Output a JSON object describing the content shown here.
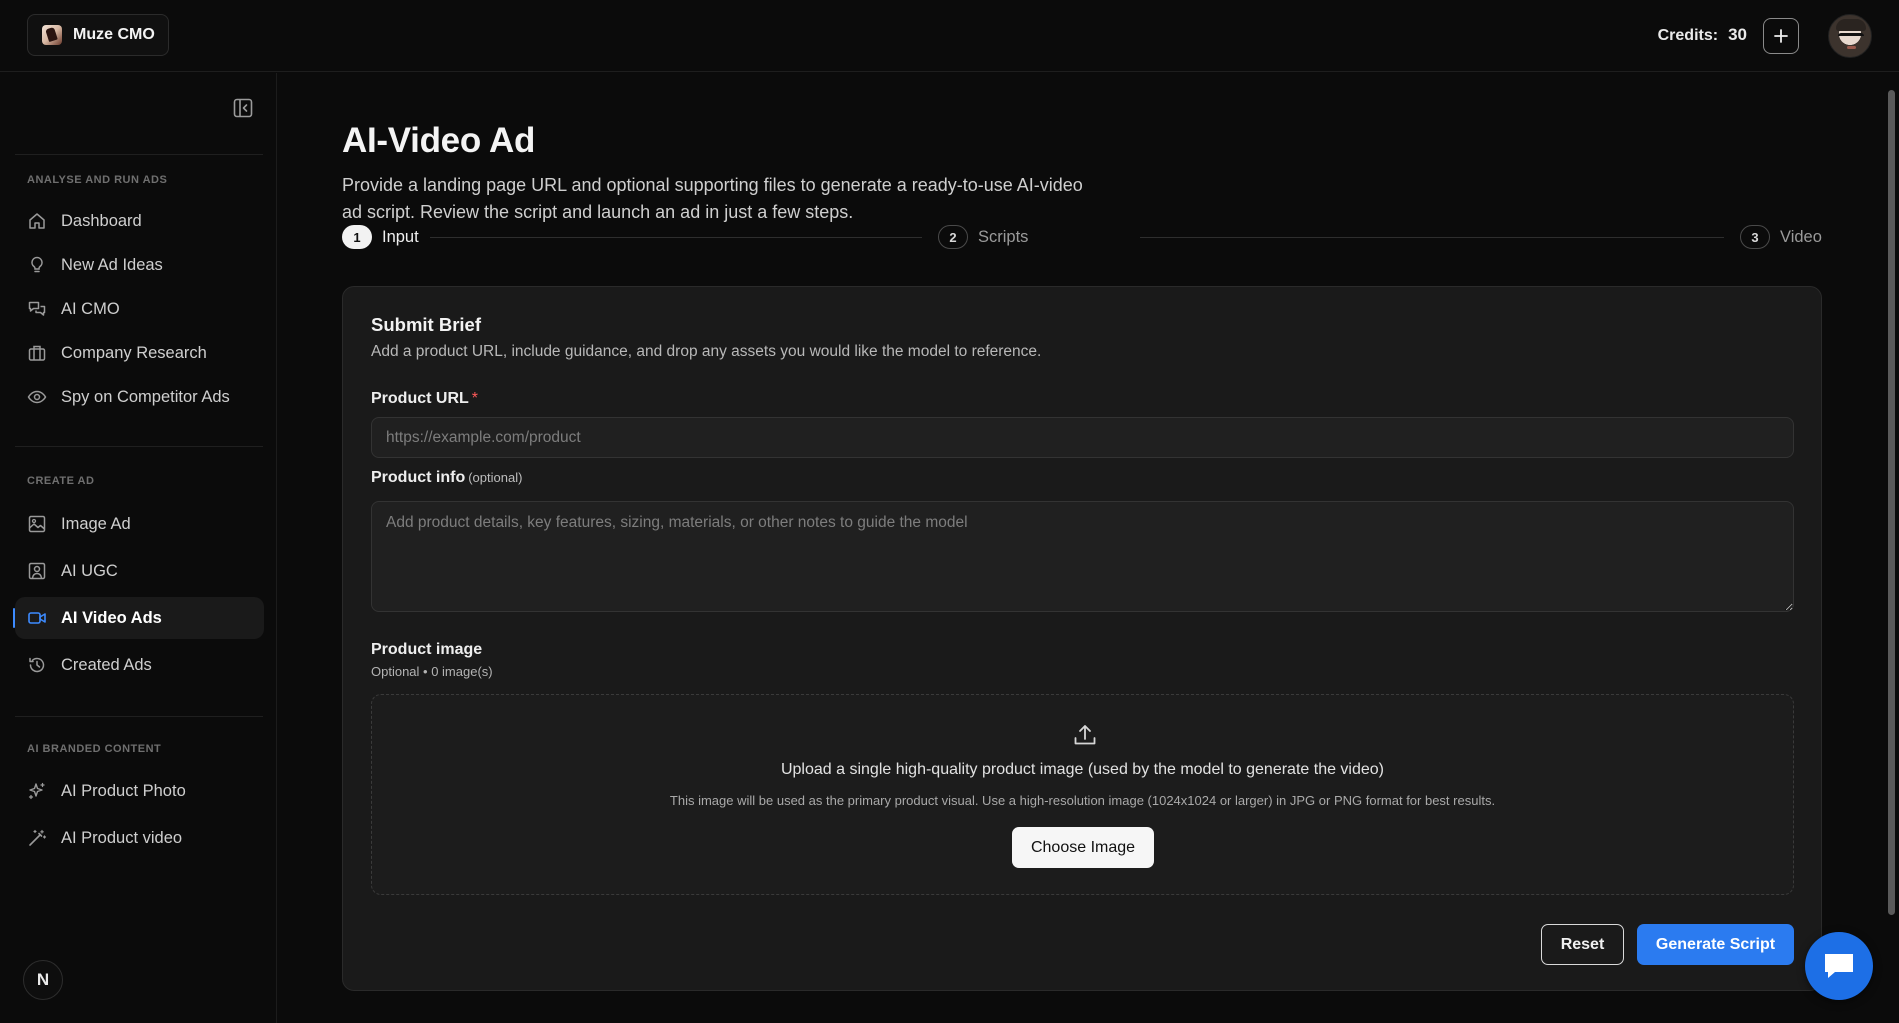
{
  "brand": {
    "name": "Muze CMO"
  },
  "header": {
    "credits_label": "Credits:",
    "credits_value": "30"
  },
  "sidebar": {
    "sections": [
      {
        "title": "ANALYSE AND RUN ADS"
      },
      {
        "title": "CREATE AD"
      },
      {
        "title": "AI BRANDED CONTENT"
      }
    ],
    "items": [
      {
        "label": "Dashboard",
        "icon": "home-icon"
      },
      {
        "label": "New Ad Ideas",
        "icon": "lightbulb-icon"
      },
      {
        "label": "AI CMO",
        "icon": "chat-bubbles-icon"
      },
      {
        "label": "Company Research",
        "icon": "briefcase-icon"
      },
      {
        "label": "Spy on Competitor Ads",
        "icon": "eye-icon"
      },
      {
        "label": "Image Ad",
        "icon": "image-icon"
      },
      {
        "label": "AI UGC",
        "icon": "user-square-icon"
      },
      {
        "label": "AI Video Ads",
        "icon": "video-camera-icon",
        "active": true
      },
      {
        "label": "Created Ads",
        "icon": "history-icon"
      },
      {
        "label": "AI Product Photo",
        "icon": "sparkles-icon"
      },
      {
        "label": "AI Product video",
        "icon": "magic-wand-icon"
      }
    ],
    "footer_badge": "N"
  },
  "main": {
    "title": "AI-Video Ad",
    "description": "Provide a landing page URL and optional supporting files to generate a ready-to-use AI-video ad script. Review the script and launch an ad in just a few steps.",
    "steps": [
      {
        "number": "1",
        "label": "Input",
        "active": true
      },
      {
        "number": "2",
        "label": "Scripts",
        "active": false
      },
      {
        "number": "3",
        "label": "Video",
        "active": false
      }
    ],
    "card": {
      "title": "Submit Brief",
      "subtitle": "Add a product URL, include guidance, and drop any assets you would like the model to reference.",
      "product_url": {
        "label": "Product URL",
        "required_mark": "*",
        "placeholder": "https://example.com/product",
        "value": ""
      },
      "product_info": {
        "label": "Product info",
        "optional_tag": "(optional)",
        "placeholder": "Add product details, key features, sizing, materials, or other notes to guide the model",
        "value": ""
      },
      "product_image": {
        "label": "Product image",
        "note": "Optional • 0 image(s)",
        "upload_title": "Upload a single high-quality product image (used by the model to generate the video)",
        "upload_note": "This image will be used as the primary product visual. Use a high-resolution image (1024x1024 or larger) in JPG or PNG format for best results.",
        "choose_label": "Choose Image"
      },
      "reset_label": "Reset",
      "generate_label": "Generate Script"
    }
  },
  "colors": {
    "accent": "#2b7bf0",
    "background": "#0b0b0b",
    "card": "#1a1a1a",
    "required": "#ff5a5a"
  }
}
